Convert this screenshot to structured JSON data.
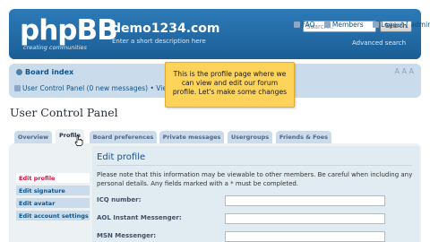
{
  "header": {
    "logo_text": "phpBB",
    "logo_subtitle": "creating communities",
    "site_title": "demo1234.com",
    "site_description": "Enter a short description here",
    "search_placeholder": "Search...",
    "search_button": "Search",
    "advanced_search": "Advanced search"
  },
  "navbar": {
    "board_index": "Board index",
    "font_resize": "A A A",
    "ucp_link": "User Control Panel (0 new messages) • Vie",
    "faq": "FAQ",
    "members": "Members",
    "logout": "Logout [ admin ]"
  },
  "tooltip": {
    "text": "This is the profile page where we can view and edit our forum profile. Let's make some changes"
  },
  "page": {
    "title": "User Control Panel"
  },
  "tabs": [
    {
      "label": "Overview"
    },
    {
      "label": "Profile"
    },
    {
      "label": "Board preferences"
    },
    {
      "label": "Private messages"
    },
    {
      "label": "Usergroups"
    },
    {
      "label": "Friends & Foes"
    }
  ],
  "side_menu": [
    {
      "label": "Edit profile"
    },
    {
      "label": "Edit signature"
    },
    {
      "label": "Edit avatar"
    },
    {
      "label": "Edit account settings"
    }
  ],
  "content": {
    "heading": "Edit profile",
    "notice": "Please note that this information may be viewable to other members. Be careful when including any personal details. Any fields marked with a * must be completed.",
    "fields": [
      {
        "label": "ICQ number:",
        "value": ""
      },
      {
        "label": "AOL Instant Messenger:",
        "value": ""
      },
      {
        "label": "MSN Messenger:",
        "value": ""
      }
    ]
  },
  "colors": {
    "header_blue": "#1b5e96",
    "navbar_bg": "#cadceb",
    "tooltip_bg": "#fdd35a",
    "active_menu_text": "#d31141"
  }
}
